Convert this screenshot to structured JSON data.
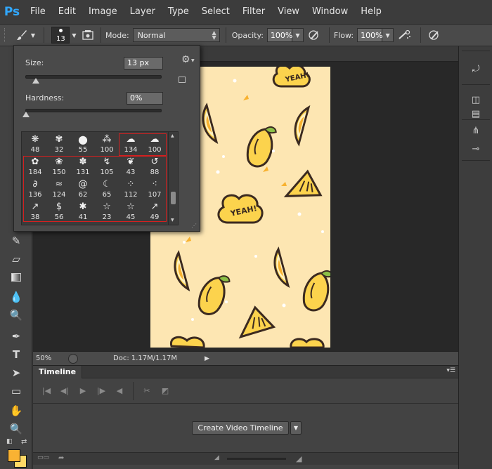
{
  "app": {
    "logo": "Ps"
  },
  "menu": [
    "File",
    "Edit",
    "Image",
    "Layer",
    "Type",
    "Select",
    "Filter",
    "View",
    "Window",
    "Help"
  ],
  "options_bar": {
    "brush_size": "13",
    "mode_label": "Mode:",
    "mode_value": "Normal",
    "opacity_label": "Opacity:",
    "opacity_value": "100%",
    "flow_label": "Flow:",
    "flow_value": "100%"
  },
  "brush_popup": {
    "size_label": "Size:",
    "size_value": "13 px",
    "size_fraction": 0.05,
    "hardness_label": "Hardness:",
    "hardness_value": "0%",
    "hardness_fraction": 0.0,
    "rows": [
      [
        "48",
        "32",
        "55",
        "100",
        "134",
        "100"
      ],
      [
        "184",
        "150",
        "131",
        "105",
        "43",
        "88"
      ],
      [
        "136",
        "124",
        "62",
        "65",
        "112",
        "107"
      ],
      [
        "38",
        "56",
        "41",
        "23",
        "45",
        "49"
      ]
    ]
  },
  "status": {
    "zoom": "50%",
    "doc": "Doc: 1.17M/1.17M"
  },
  "timeline": {
    "tab_label": "Timeline",
    "create_button": "Create Video Timeline"
  },
  "artwork": {
    "text1": "YEAH!",
    "text2": "YEAH!"
  },
  "colors": {
    "accent": "#31a8ff",
    "highlight": "#d42020",
    "foreground": "#f9b233",
    "background": "#ffd966"
  }
}
